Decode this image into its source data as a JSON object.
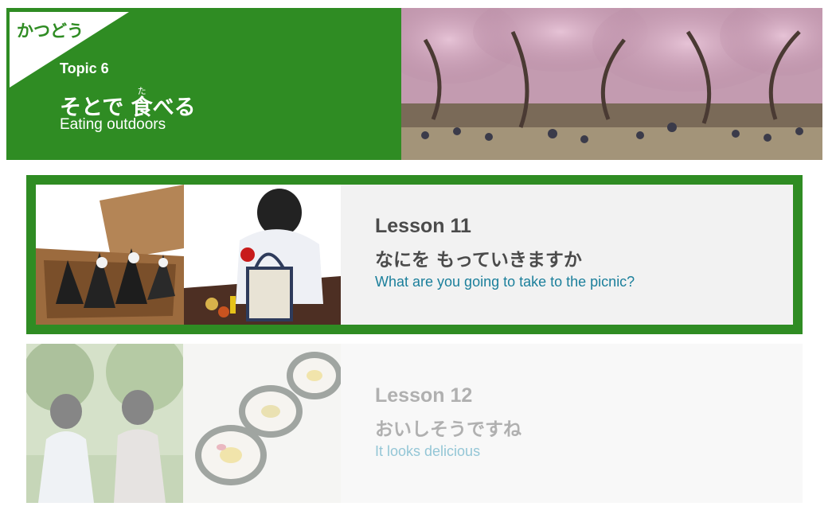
{
  "header": {
    "corner_label": "かつどう",
    "topic_number": "Topic 6",
    "title_prefix": "そとで ",
    "title_kanji": "食",
    "title_kanji_reading": "た",
    "title_suffix": "べる",
    "subtitle": "Eating outdoors",
    "theme_color": "#2f8c23"
  },
  "lessons": [
    {
      "number": "Lesson 11",
      "title_jp": "なにを もっていきますか",
      "title_en": "What are you going to take to the picnic?",
      "state": "selected"
    },
    {
      "number": "Lesson 12",
      "title_jp": "おいしそうですね",
      "title_en": "It looks delicious",
      "state": "faded"
    }
  ]
}
